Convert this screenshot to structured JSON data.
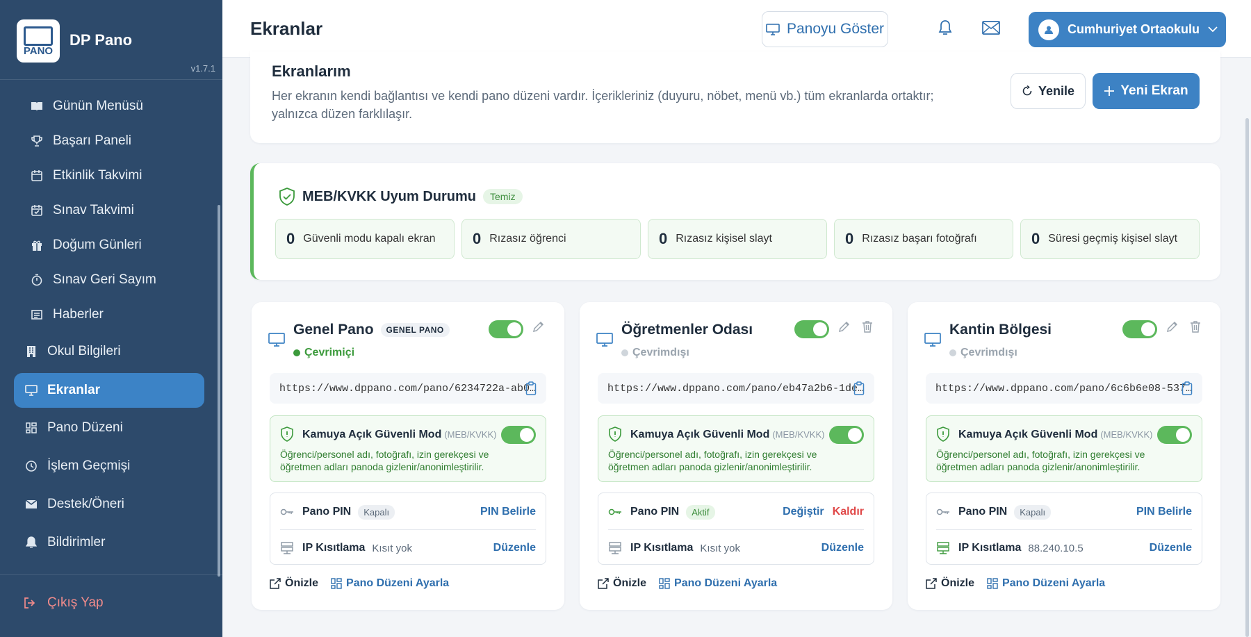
{
  "brand": {
    "name": "DP Pano",
    "logo_text": "PANO",
    "version": "v1.7.1"
  },
  "sidebar": {
    "items": [
      {
        "label": "Günün Menüsü",
        "icon": "book-icon"
      },
      {
        "label": "Başarı Paneli",
        "icon": "trophy-icon"
      },
      {
        "label": "Etkinlik Takvimi",
        "icon": "calendar-icon"
      },
      {
        "label": "Sınav Takvimi",
        "icon": "calendar-check-icon"
      },
      {
        "label": "Doğum Günleri",
        "icon": "gift-icon"
      },
      {
        "label": "Sınav Geri Sayım",
        "icon": "stopwatch-icon"
      },
      {
        "label": "Haberler",
        "icon": "newspaper-icon"
      },
      {
        "label": "Okul Bilgileri",
        "icon": "building-icon"
      },
      {
        "label": "Ekranlar",
        "icon": "monitor-icon"
      },
      {
        "label": "Pano Düzeni",
        "icon": "layout-icon"
      },
      {
        "label": "İşlem Geçmişi",
        "icon": "clock-icon"
      },
      {
        "label": "Destek/Öneri",
        "icon": "envelope-icon"
      },
      {
        "label": "Bildirimler",
        "icon": "bell-icon"
      }
    ],
    "logout": "Çıkış Yap"
  },
  "header": {
    "title": "Ekranlar",
    "show_board": "Panoyu Göster",
    "user": "Cumhuriyet Ortaokulu"
  },
  "intro": {
    "title": "Ekranlarım",
    "description": "Her ekranın kendi bağlantısı ve kendi pano düzeni vardır. İçerikleriniz (duyuru, nöbet, menü vb.) tüm ekranlarda ortaktır; yalnızca düzen farklılaşır.",
    "refresh": "Yenile",
    "new_screen": "Yeni Ekran"
  },
  "compliance": {
    "title": "MEB/KVKK Uyum Durumu",
    "badge": "Temiz",
    "stats": [
      {
        "count": "0",
        "label": "Güvenli modu kapalı ekran"
      },
      {
        "count": "0",
        "label": "Rızasız öğrenci"
      },
      {
        "count": "0",
        "label": "Rızasız kişisel slayt"
      },
      {
        "count": "0",
        "label": "Rızasız başarı fotoğrafı"
      },
      {
        "count": "0",
        "label": "Süresi geçmiş kişisel slayt"
      }
    ]
  },
  "screens": [
    {
      "name": "Genel Pano",
      "tag": "GENEL PANO",
      "status": "Çevrimiçi",
      "url": "https://www.dppano.com/pano/6234722a-ab0…",
      "safe_title": "Kamuya Açık Güvenli Mod",
      "safe_sub": "(MEB/KVKK)",
      "safe_desc": "Öğrenci/personel adı, fotoğrafı, izin gerekçesi ve öğretmen adları panoda gizlenir/anonimleştirilir.",
      "pin_label": "Pano PIN",
      "pin_state": "Kapalı",
      "pin_action": "PIN Belirle",
      "ip_label": "IP Kısıtlama",
      "ip_value": "Kısıt yok",
      "ip_action": "Düzenle",
      "preview": "Önizle",
      "layout": "Pano Düzeni Ayarla"
    },
    {
      "name": "Öğretmenler Odası",
      "status": "Çevrimdışı",
      "url": "https://www.dppano.com/pano/eb47a2b6-1de…",
      "safe_title": "Kamuya Açık Güvenli Mod",
      "safe_sub": "(MEB/KVKK)",
      "safe_desc": "Öğrenci/personel adı, fotoğrafı, izin gerekçesi ve öğretmen adları panoda gizlenir/anonimleştirilir.",
      "pin_label": "Pano PIN",
      "pin_state": "Aktif",
      "pin_change": "Değiştir",
      "pin_remove": "Kaldır",
      "ip_label": "IP Kısıtlama",
      "ip_value": "Kısıt yok",
      "ip_action": "Düzenle",
      "preview": "Önizle",
      "layout": "Pano Düzeni Ayarla"
    },
    {
      "name": "Kantin Bölgesi",
      "status": "Çevrimdışı",
      "url": "https://www.dppano.com/pano/6c6b6e08-537…",
      "safe_title": "Kamuya Açık Güvenli Mod",
      "safe_sub": "(MEB/KVKK)",
      "safe_desc": "Öğrenci/personel adı, fotoğrafı, izin gerekçesi ve öğretmen adları panoda gizlenir/anonimleştirilir.",
      "pin_label": "Pano PIN",
      "pin_state": "Kapalı",
      "pin_action": "PIN Belirle",
      "ip_label": "IP Kısıtlama",
      "ip_value": "88.240.10.5",
      "ip_action": "Düzenle",
      "preview": "Önizle",
      "layout": "Pano Düzeni Ayarla"
    }
  ],
  "colors": {
    "sidebar": "#2d4a6b",
    "accent": "#3d82c4",
    "success": "#5cb85c",
    "danger": "#e04848"
  }
}
